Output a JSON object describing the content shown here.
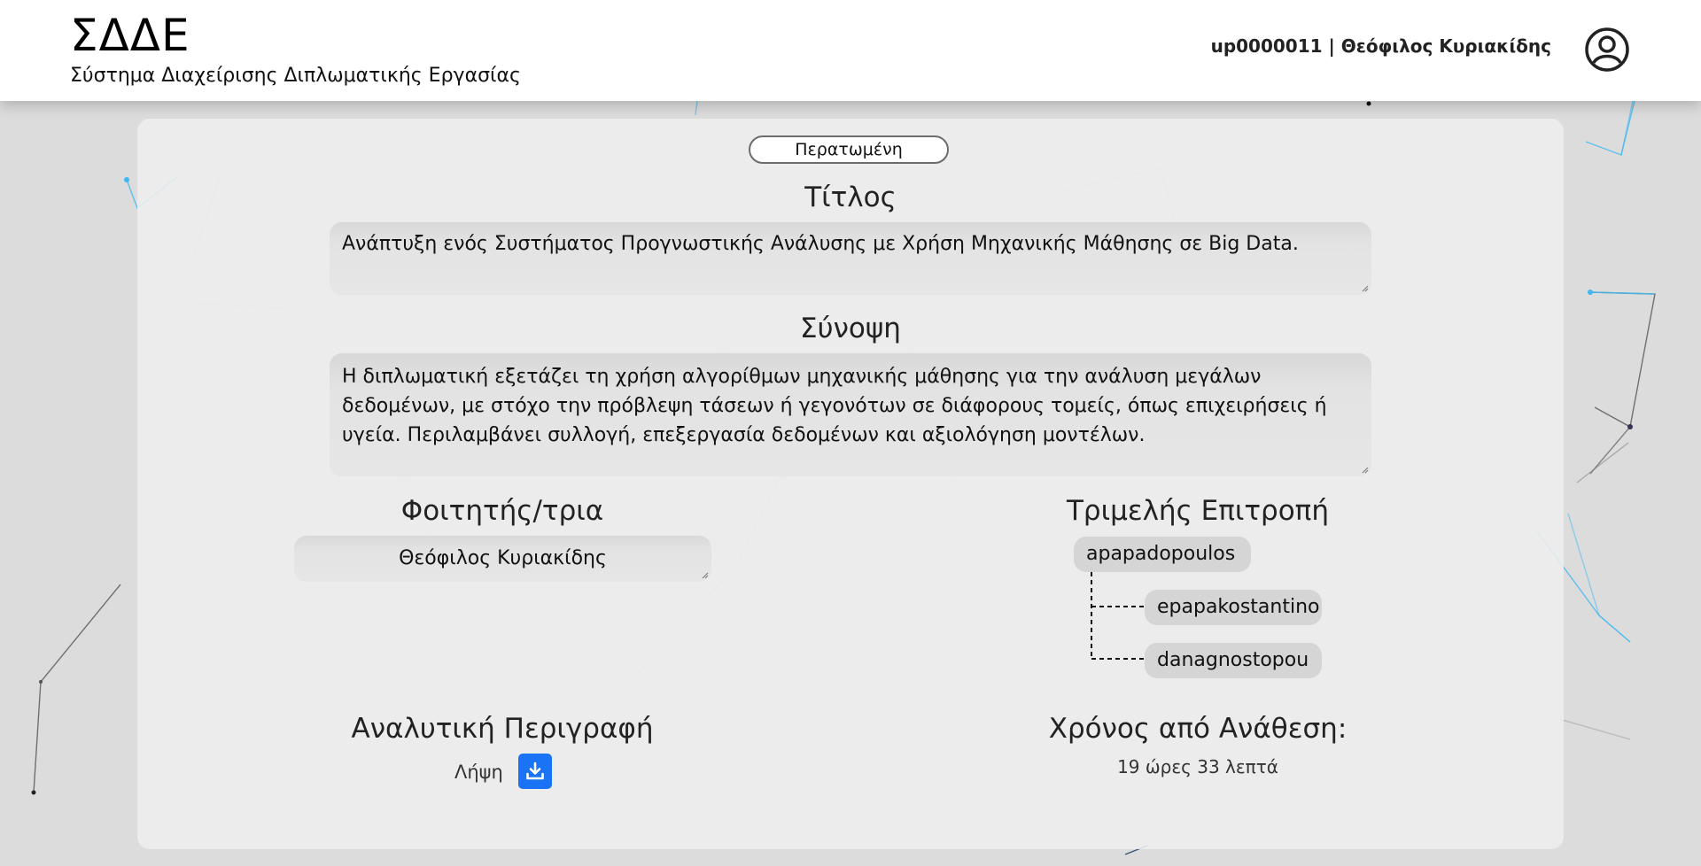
{
  "header": {
    "app_name": "ΣΔΔΕ",
    "app_subtitle": "Σύστημα Διαχείρισης Διπλωματικής Εργασίας",
    "user_label": "up0000011 | Θεόφιλος Κυριακίδης",
    "avatar_icon": "user-circle-icon"
  },
  "thesis": {
    "status": "Περατωμένη",
    "title_heading": "Τίτλος",
    "title_value": "Ανάπτυξη ενός Συστήματος Προγνωστικής Ανάλυσης με Χρήση Μηχανικής Μάθησης σε Big Data.",
    "summary_heading": "Σύνοψη",
    "summary_value": "Η διπλωματική εξετάζει τη χρήση αλγορίθμων μηχανικής μάθησης για την ανάλυση μεγάλων δεδομένων, με στόχο την πρόβλεψη τάσεων ή γεγονότων σε διάφορους τομείς, όπως επιχειρήσεις ή υγεία. Περιλαμβάνει συλλογή, επεξεργασία δεδομένων και αξιολόγηση μοντέλων.",
    "student_heading": "Φοιτητής/τρια",
    "student_value": "Θεόφιλος Κυριακίδης",
    "committee_heading": "Τριμελής Επιτροπή",
    "committee": {
      "supervisor": "apapadopoulos",
      "members": [
        "epapakostantino",
        "danagnostopou"
      ]
    },
    "description_heading": "Αναλυτική Περιγραφή",
    "download_label": "Λήψη",
    "download_icon": "download-icon",
    "elapsed_heading": "Χρόνος από Ανάθεση:",
    "elapsed_value": "19 ώρες 33 λεπτά"
  },
  "colors": {
    "accent": "#1a73f5",
    "background": "#dcdcdc",
    "card": "#eeeeee",
    "network_line": "#3fb8f0"
  }
}
